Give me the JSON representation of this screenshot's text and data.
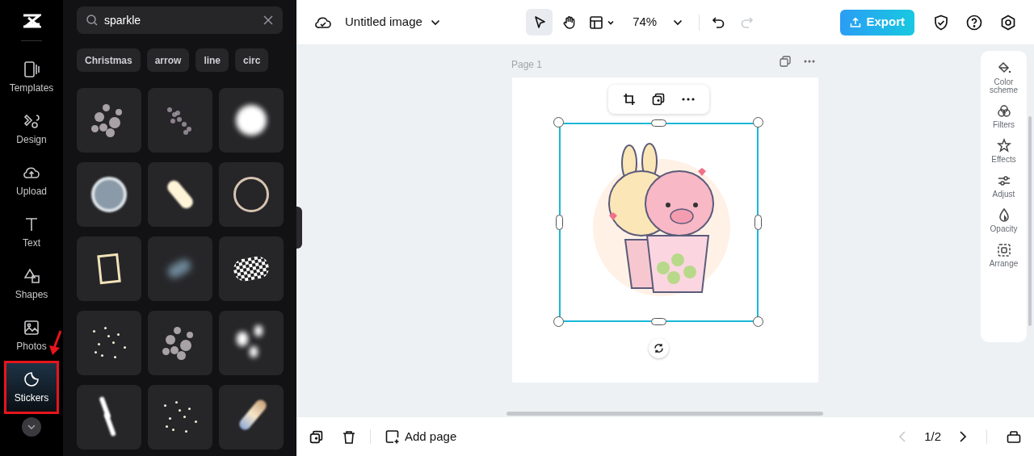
{
  "sidebar": {
    "items": [
      {
        "label": "Templates",
        "selected": false
      },
      {
        "label": "Design",
        "selected": false
      },
      {
        "label": "Upload",
        "selected": false
      },
      {
        "label": "Text",
        "selected": false
      },
      {
        "label": "Shapes",
        "selected": false
      },
      {
        "label": "Photos",
        "selected": false
      },
      {
        "label": "Stickers",
        "selected": true
      }
    ]
  },
  "panel": {
    "search": {
      "value": "sparkle"
    },
    "chips": [
      "Christmas",
      "arrow",
      "line",
      "circ"
    ],
    "stickers": [
      {
        "kind": "cluster"
      },
      {
        "kind": "scatter"
      },
      {
        "kind": "glow"
      },
      {
        "kind": "ring-soft"
      },
      {
        "kind": "oval"
      },
      {
        "kind": "ring"
      },
      {
        "kind": "frame"
      },
      {
        "kind": "smudge"
      },
      {
        "kind": "checker"
      },
      {
        "kind": "dots"
      },
      {
        "kind": "cluster"
      },
      {
        "kind": "blobs"
      },
      {
        "kind": "streaks"
      },
      {
        "kind": "dots"
      },
      {
        "kind": "prism"
      }
    ]
  },
  "topbar": {
    "title": "Untitled image",
    "tools": [
      {
        "kind": "pointer",
        "selected": true
      },
      {
        "kind": "hand",
        "selected": false
      }
    ],
    "zoom": "74%",
    "undo": {
      "disabled": false
    },
    "redo": {
      "disabled": true
    },
    "export": "Export"
  },
  "canvas": {
    "page_label": "Page 1"
  },
  "right_tools": [
    "Color scheme",
    "Filters",
    "Effects",
    "Adjust",
    "Opacity",
    "Arrange"
  ],
  "bottombar": {
    "add_page": "Add page",
    "page_counter": "1/2",
    "previous": {
      "disabled": true
    },
    "next": {
      "disabled": false
    }
  }
}
